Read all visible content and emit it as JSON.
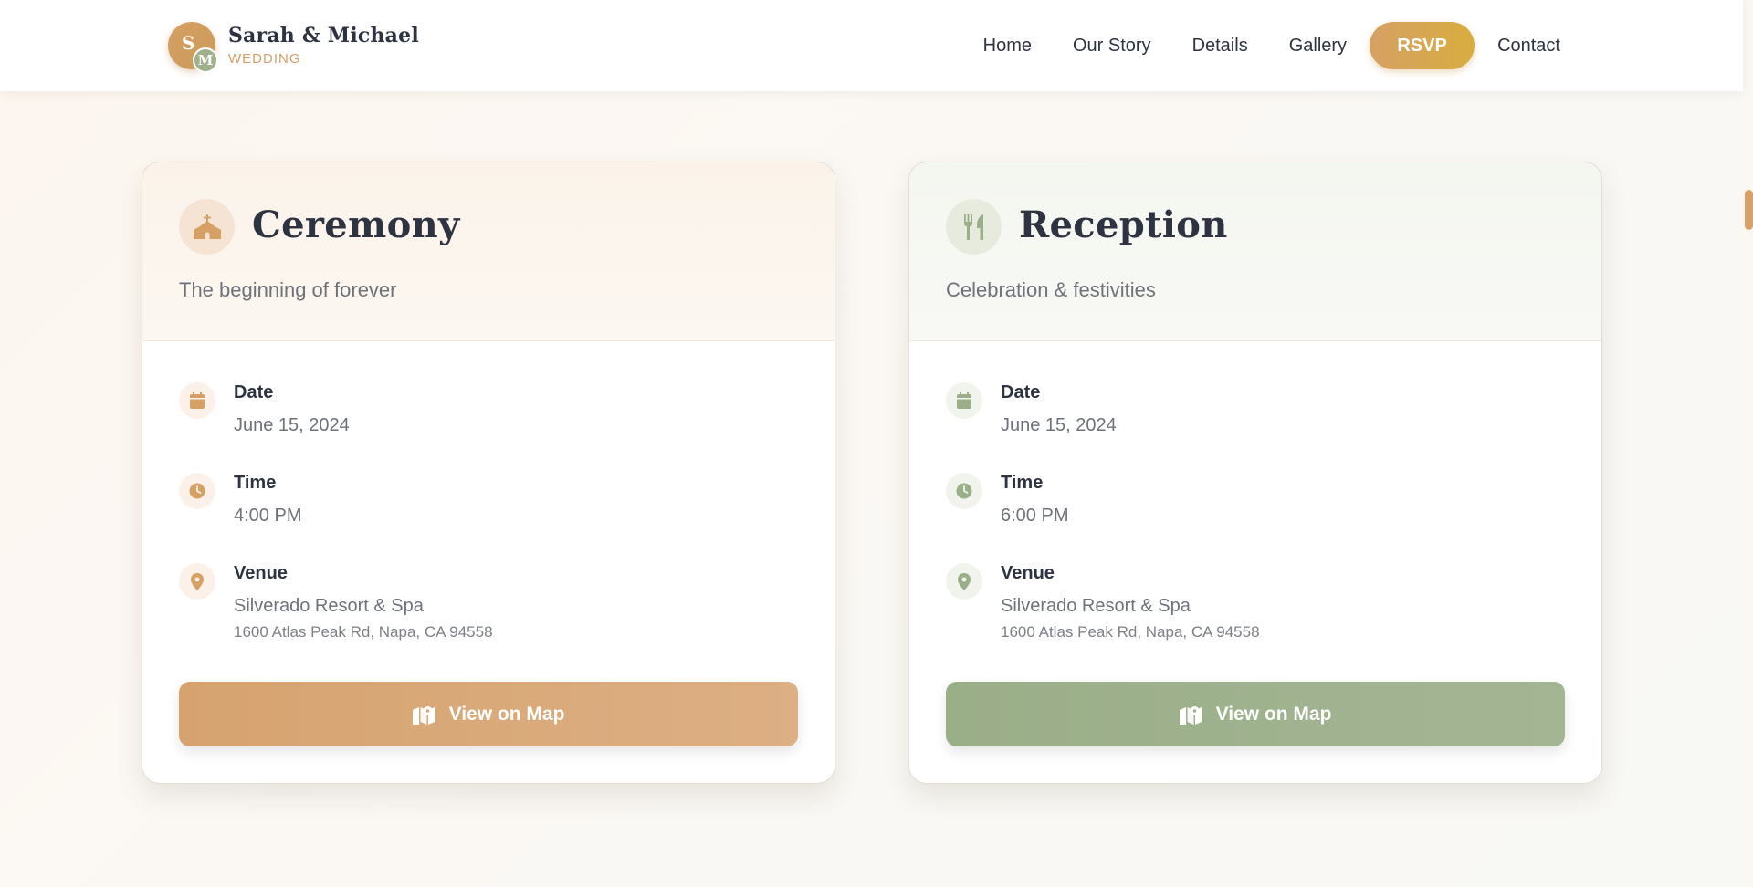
{
  "brand": {
    "monogram_first": "S",
    "monogram_second": "M",
    "name": "Sarah & Michael",
    "subtitle": "WEDDING"
  },
  "nav": {
    "items": [
      "Home",
      "Our Story",
      "Details",
      "Gallery"
    ],
    "rsvp": "RSVP",
    "contact": "Contact"
  },
  "colors": {
    "ceremony_accent": "#d6a064",
    "reception_accent": "#9aae88",
    "text_dark": "#2d3340",
    "text_muted": "#6e727a"
  },
  "cards": [
    {
      "icon": "church-icon",
      "title": "Ceremony",
      "subtitle": "The beginning of forever",
      "date_label": "Date",
      "date_value": "June 15, 2024",
      "time_label": "Time",
      "time_value": "4:00 PM",
      "venue_label": "Venue",
      "venue_name": "Silverado Resort & Spa",
      "venue_address": "1600 Atlas Peak Rd, Napa, CA 94558",
      "button_label": "View on Map"
    },
    {
      "icon": "utensils-icon",
      "title": "Reception",
      "subtitle": "Celebration & festivities",
      "date_label": "Date",
      "date_value": "June 15, 2024",
      "time_label": "Time",
      "time_value": "6:00 PM",
      "venue_label": "Venue",
      "venue_name": "Silverado Resort & Spa",
      "venue_address": "1600 Atlas Peak Rd, Napa, CA 94558",
      "button_label": "View on Map"
    }
  ]
}
